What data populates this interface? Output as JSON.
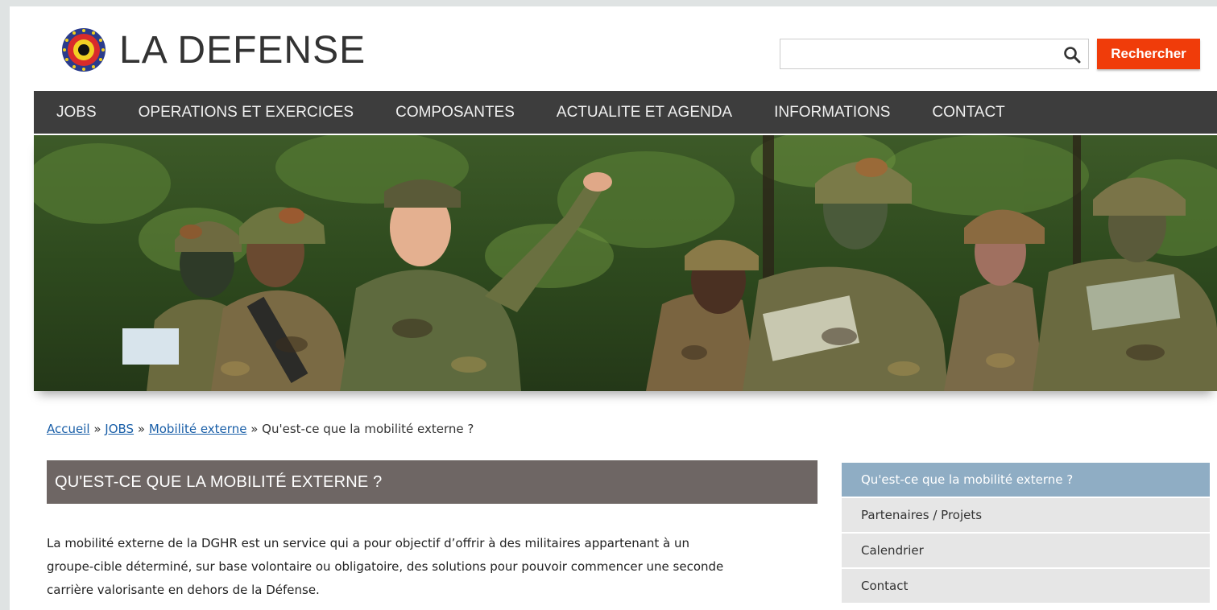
{
  "header": {
    "site_title": "LA DEFENSE",
    "search": {
      "placeholder": "",
      "value": "",
      "button_label": "Rechercher"
    }
  },
  "nav": {
    "items": [
      {
        "label": "JOBS"
      },
      {
        "label": "OPERATIONS ET EXERCICES"
      },
      {
        "label": "COMPOSANTES"
      },
      {
        "label": "ACTUALITE ET AGENDA"
      },
      {
        "label": "INFORMATIONS"
      },
      {
        "label": "CONTACT"
      }
    ]
  },
  "breadcrumb": {
    "items": [
      {
        "label": "Accueil"
      },
      {
        "label": "JOBS"
      },
      {
        "label": "Mobilité externe"
      }
    ],
    "separator": "»",
    "current": "Qu'est-ce que la mobilité externe ?"
  },
  "main": {
    "title": "QU'EST-CE QUE LA MOBILITÉ EXTERNE ?",
    "paragraph_lines": [
      "La mobilité externe de la DGHR est un service qui a pour objectif d’offrir à des militaires appartenant à un",
      "groupe-cible déterminé, sur base volontaire ou obligatoire, des solutions pour pouvoir commencer une seconde",
      "carrière valorisante en dehors de la Défense."
    ]
  },
  "sidebar": {
    "items": [
      {
        "label": "Qu'est-ce que la mobilité externe ?",
        "active": true
      },
      {
        "label": "Partenaires / Projets",
        "active": false
      },
      {
        "label": "Calendrier",
        "active": false
      },
      {
        "label": "Contact",
        "active": false
      }
    ]
  },
  "colors": {
    "accent_button": "#f03c0a",
    "nav_bg": "#3d3d3d",
    "title_bar": "#6e6664",
    "sidebar_active": "#8fadc4",
    "link": "#1a5fa8"
  },
  "icons": {
    "logo": "belgian-roundel-icon",
    "search": "magnifier-icon"
  }
}
